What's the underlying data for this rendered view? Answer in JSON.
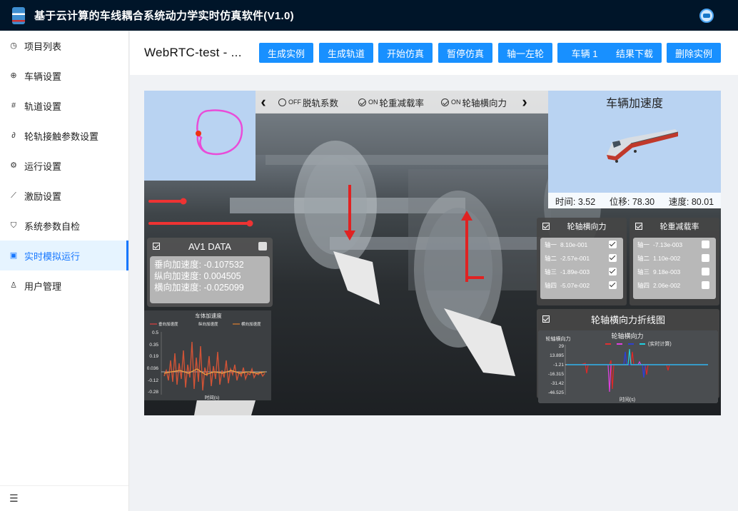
{
  "header": {
    "title": "基于云计算的车线耦合系统动力学实时仿真软件(V1.0)"
  },
  "sidebar": {
    "items": [
      {
        "label": "项目列表",
        "icon": "dashboard-icon"
      },
      {
        "label": "车辆设置",
        "icon": "globe-icon"
      },
      {
        "label": "轨道设置",
        "icon": "hash-icon"
      },
      {
        "label": "轮轨接触参数设置",
        "icon": "link-icon"
      },
      {
        "label": "运行设置",
        "icon": "gear-icon"
      },
      {
        "label": "激励设置",
        "icon": "line-chart-icon"
      },
      {
        "label": "系统参数自检",
        "icon": "shield-icon"
      },
      {
        "label": "实时模拟运行",
        "icon": "monitor-icon",
        "active": true
      },
      {
        "label": "用户管理",
        "icon": "user-icon"
      }
    ]
  },
  "toolbar": {
    "project_name": "WebRTC-test - ...",
    "buttons": [
      "生成实例",
      "生成轨道",
      "开始仿真",
      "暂停仿真",
      "轴一左轮",
      "车辆 1",
      "结果下载",
      "删除实例"
    ]
  },
  "scene": {
    "modes": [
      {
        "state": "OFF",
        "label": "脱轨系数"
      },
      {
        "state": "ON",
        "label": "轮重减载率"
      },
      {
        "state": "ON",
        "label": "轮轴横向力"
      }
    ],
    "accel_panel": {
      "title": "车辆加速度",
      "time_label": "时间: 3.52",
      "disp_label": "位移: 78.30",
      "speed_label": "速度: 80.01"
    },
    "av1": {
      "title": "AV1 DATA",
      "vertical": "垂向加速度: -0.107532",
      "longitudinal": "纵向加速度: 0.004505",
      "lateral": "横向加速度: -0.025099"
    },
    "av1_chart": {
      "title": "车体加速度",
      "legend": [
        "垂向加速度",
        "纵向加速度",
        "横向加速度"
      ],
      "yticks": [
        "0.5",
        "0.35",
        "0.19",
        "0.036",
        "-0.12",
        "-0.28"
      ],
      "xlabel": "时间(s)"
    },
    "lateral_force_panel": {
      "title": "轮轴横向力",
      "rows": [
        {
          "name": "轴一",
          "value": "8.10e-001"
        },
        {
          "name": "轴二",
          "value": "-2.57e-001"
        },
        {
          "name": "轴三",
          "value": "-1.89e-003"
        },
        {
          "name": "轴四",
          "value": "-5.07e-002"
        }
      ]
    },
    "unloading_panel": {
      "title": "轮重减载率",
      "rows": [
        {
          "name": "轴一",
          "value": "-7.13e-003"
        },
        {
          "name": "轴二",
          "value": "1.10e-002"
        },
        {
          "name": "轴三",
          "value": "9.18e-003"
        },
        {
          "name": "轴四",
          "value": "2.06e-002"
        }
      ]
    },
    "lateral_line_panel": {
      "title": "轮轴横向力折线图",
      "chart_title": "轮轴横向力",
      "ylabel": "轮轴横向力",
      "legend_realtime": "(实时计算)",
      "yticks": [
        "29",
        "13.895",
        "-1.21",
        "-16.315",
        "-31.42",
        "-46.525"
      ],
      "xlabel": "时间(s)"
    }
  },
  "colors": {
    "header_bg": "#001529",
    "primary": "#1890ff",
    "active_nav": "#1677ff",
    "active_nav_bg": "#e6f4ff",
    "info_panel_bg": "#b9d3f2"
  }
}
